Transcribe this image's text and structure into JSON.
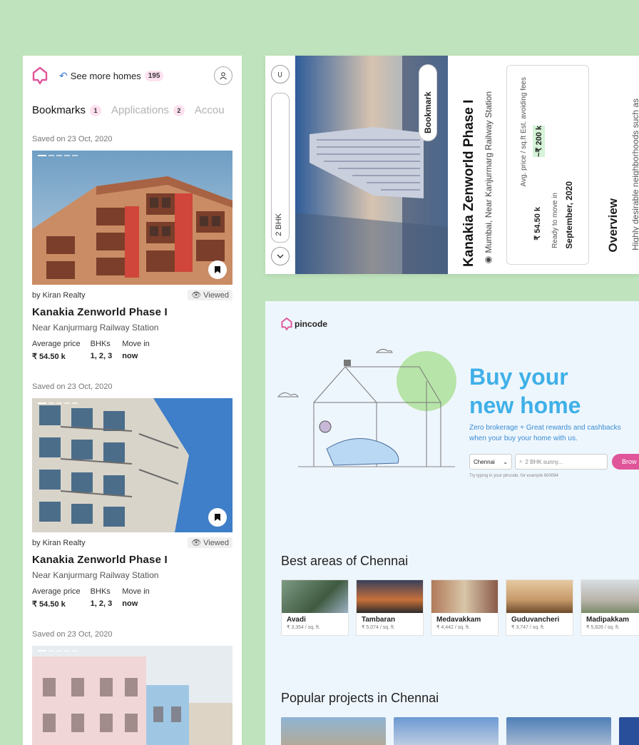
{
  "app": {
    "accent": "#e0559a",
    "background": "#bfe3bc"
  },
  "phone": {
    "header": {
      "see_more_label": "See more homes",
      "see_more_count": "195"
    },
    "tabs": [
      {
        "label": "Bookmarks",
        "count": "1",
        "active": true
      },
      {
        "label": "Applications",
        "count": "2",
        "active": false
      },
      {
        "label": "Accou",
        "count": "",
        "active": false
      }
    ],
    "cards": [
      {
        "saved": "Saved on 23 Oct, 2020",
        "agent": "by Kiran Realty",
        "viewed": "Viewed",
        "title": "Kanakia Zenworld Phase I",
        "location": "Near Kanjurmarg Railway Station",
        "price_label": "Average price",
        "price": "₹ 54.50 k",
        "bhk_label": "BHKs",
        "bhk": "1, 2, 3",
        "move_label": "Move in",
        "move": "now"
      },
      {
        "saved": "Saved on 23 Oct, 2020",
        "agent": "by Kiran Realty",
        "viewed": "Viewed",
        "title": "Kanakia Zenworld Phase I",
        "location": "Near Kanjurmarg Railway Station",
        "price_label": "Average price",
        "price": "₹ 54.50 k",
        "bhk_label": "BHKs",
        "bhk": "1, 2, 3",
        "move_label": "Move in",
        "move": "now"
      },
      {
        "saved": "Saved on 23 Oct, 2020"
      }
    ]
  },
  "detail": {
    "search_text": "2 BHK",
    "bookmark_label": "Bookmark",
    "title": "Kanakia Zenworld Phase I",
    "location": "Mumbai, Near Kanjurmarg Railway Station",
    "avg_price_label": "Avg. price / sq.ft",
    "avg_price": "₹ 54.50 k",
    "fees_label": "Est. avoiding fees",
    "fees": "~₹ 200 k",
    "ready_label": "Ready to move in",
    "ready": "September, 2020",
    "overview_label": "Overview",
    "overview_text": "Highly desirable neighborhoods such as"
  },
  "landing": {
    "brand": "pincode",
    "hero_line1": "Buy your",
    "hero_line2": "new home",
    "hero_sub": "Zero brokerage + Great rewards and cashbacks when your buy your home with us.",
    "city": "Chennai",
    "search_placeholder": "2 BHK sunny...",
    "browse_label": "Brow",
    "hint": "Try typing in your pincode, for example 600094",
    "areas_heading": "Best areas of Chennai",
    "areas": [
      {
        "name": "Avadi",
        "price": "₹ 3,354 / sq. ft."
      },
      {
        "name": "Tambaran",
        "price": "₹ 5,074 / sq. ft."
      },
      {
        "name": "Medavakkam",
        "price": "₹ 4,442 / sq. ft."
      },
      {
        "name": "Guduvancheri",
        "price": "₹ 3,747 / sq. ft."
      },
      {
        "name": "Madipakkam",
        "price": "₹ 5,826 / sq. ft."
      }
    ],
    "projects_heading": "Popular projects in Chennai"
  }
}
